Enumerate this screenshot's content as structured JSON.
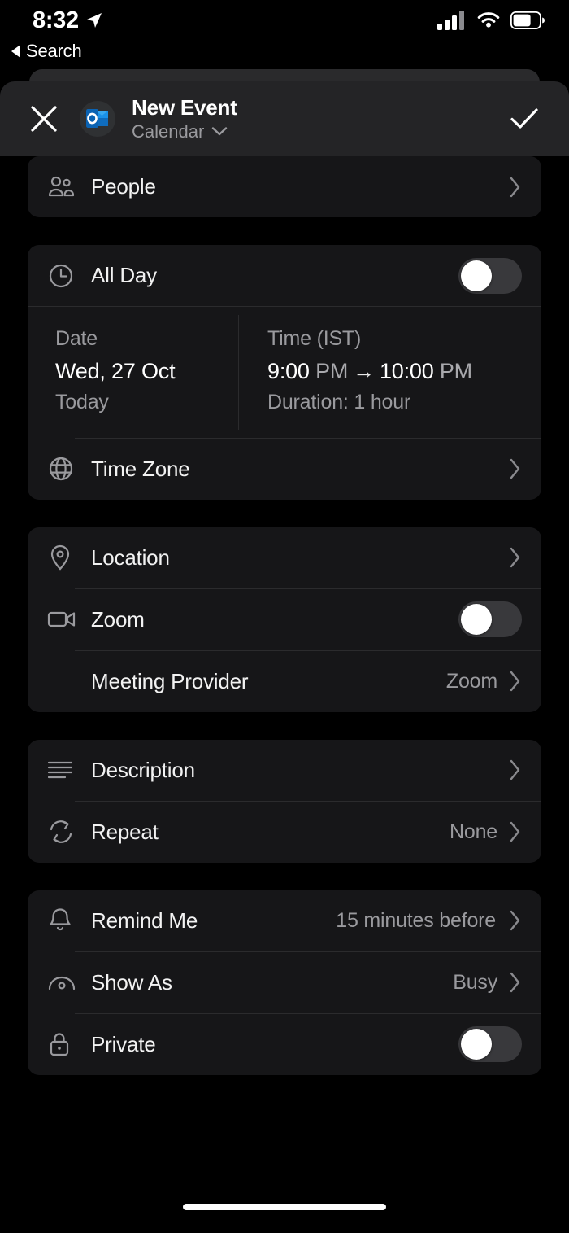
{
  "status_bar": {
    "time": "8:32",
    "location_icon": "location-arrow-icon",
    "cellular_icon": "cellular-signal-icon",
    "wifi_icon": "wifi-icon",
    "battery_icon": "battery-icon",
    "battery_level_pct": 65
  },
  "back": {
    "label": "Search",
    "icon": "back-triangle-icon"
  },
  "header": {
    "close_icon": "close-icon",
    "app_icon": "outlook-app-icon",
    "title": "New Event",
    "subtitle": "Calendar",
    "subtitle_chevron_icon": "chevron-down-icon",
    "done_icon": "checkmark-icon"
  },
  "colors": {
    "background": "#000000",
    "card": "#161618",
    "header": "#242426",
    "divider": "#2b2b2d",
    "primary_text": "#f2f2f2",
    "secondary_text": "#9a9a9e",
    "toggle_off_track": "#39393c",
    "toggle_knob": "#ffffff",
    "outlook_blue": "#0f6cbd"
  },
  "sections": [
    {
      "id": "people",
      "rows": [
        {
          "id": "people",
          "icon": "people-icon",
          "label": "People",
          "type": "chevron"
        }
      ]
    },
    {
      "id": "datetime",
      "rows": [
        {
          "id": "all-day",
          "icon": "clock-icon",
          "label": "All Day",
          "type": "toggle",
          "value_on": false
        }
      ],
      "datetime": {
        "date_caption": "Date",
        "date_value": "Wed, 27 Oct",
        "date_relative": "Today",
        "time_caption": "Time (IST)",
        "time_start": "9:00",
        "time_start_meridiem": "PM",
        "time_arrow": "→",
        "time_end": "10:00",
        "time_end_meridiem": "PM",
        "duration": "Duration: 1 hour"
      },
      "rows_after": [
        {
          "id": "time-zone",
          "icon": "globe-icon",
          "label": "Time Zone",
          "type": "chevron"
        }
      ]
    },
    {
      "id": "location",
      "rows": [
        {
          "id": "location",
          "icon": "map-pin-icon",
          "label": "Location",
          "type": "chevron"
        },
        {
          "id": "zoom",
          "icon": "video-camera-icon",
          "label": "Zoom",
          "type": "toggle",
          "value_on": false
        },
        {
          "id": "meeting-provider",
          "icon": null,
          "label": "Meeting Provider",
          "type": "value-chevron",
          "value": "Zoom"
        }
      ]
    },
    {
      "id": "details",
      "rows": [
        {
          "id": "description",
          "icon": "lines-icon",
          "label": "Description",
          "type": "chevron"
        },
        {
          "id": "repeat",
          "icon": "repeat-icon",
          "label": "Repeat",
          "type": "value-chevron",
          "value": "None"
        }
      ]
    },
    {
      "id": "options",
      "rows": [
        {
          "id": "remind-me",
          "icon": "bell-icon",
          "label": "Remind Me",
          "type": "value-chevron",
          "value": "15 minutes before"
        },
        {
          "id": "show-as",
          "icon": "eye-icon",
          "label": "Show As",
          "type": "value-chevron",
          "value": "Busy"
        },
        {
          "id": "private",
          "icon": "lock-icon",
          "label": "Private",
          "type": "toggle",
          "value_on": false
        }
      ]
    }
  ],
  "home_indicator": "home-indicator"
}
